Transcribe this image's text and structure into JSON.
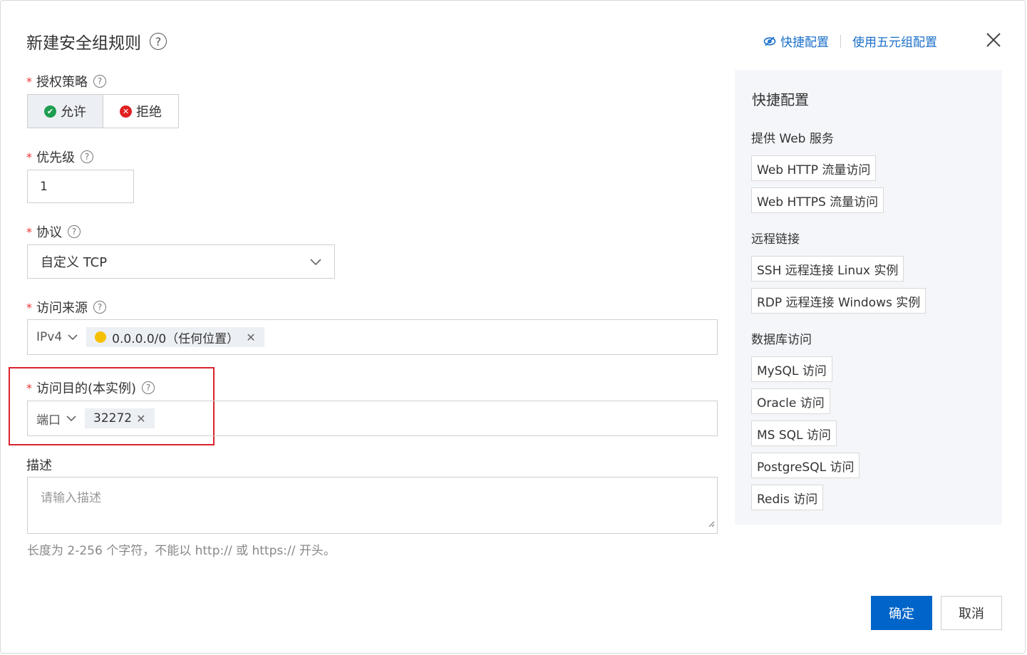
{
  "dialog": {
    "title": "新建安全组规则",
    "help_glyph": "?",
    "top_links": {
      "quick": "快捷配置",
      "five_tuple": "使用五元组配置"
    }
  },
  "form": {
    "policy": {
      "label": "授权策略",
      "allow": "允许",
      "deny": "拒绝",
      "selected": "允许"
    },
    "priority": {
      "label": "优先级",
      "value": "1"
    },
    "protocol": {
      "label": "协议",
      "value": "自定义 TCP"
    },
    "source": {
      "label": "访问来源",
      "type": "IPv4",
      "tag": "0.0.0.0/0（任何位置）"
    },
    "destination": {
      "label": "访问目的(本实例)",
      "type": "端口",
      "tag": "32272"
    },
    "description": {
      "label": "描述",
      "placeholder": "请输入描述",
      "hint": "长度为 2-256 个字符，不能以 http:// 或 https:// 开头。"
    },
    "required_mark": "*"
  },
  "sidebar": {
    "title": "快捷配置",
    "groups": [
      {
        "name": "提供 Web 服务",
        "items": [
          "Web HTTP 流量访问",
          "Web HTTPS 流量访问"
        ]
      },
      {
        "name": "远程链接",
        "items": [
          "SSH 远程连接 Linux 实例",
          "RDP 远程连接 Windows 实例"
        ]
      },
      {
        "name": "数据库访问",
        "items": [
          "MySQL 访问",
          "Oracle 访问",
          "MS SQL 访问",
          "PostgreSQL 访问",
          "Redis 访问"
        ]
      }
    ]
  },
  "footer": {
    "confirm": "确定",
    "cancel": "取消"
  },
  "colors": {
    "primary": "#0064c8",
    "allow": "#1e9e4f",
    "deny": "#e02020",
    "highlight_box": "#d9232d",
    "warning": "#f6c000"
  }
}
